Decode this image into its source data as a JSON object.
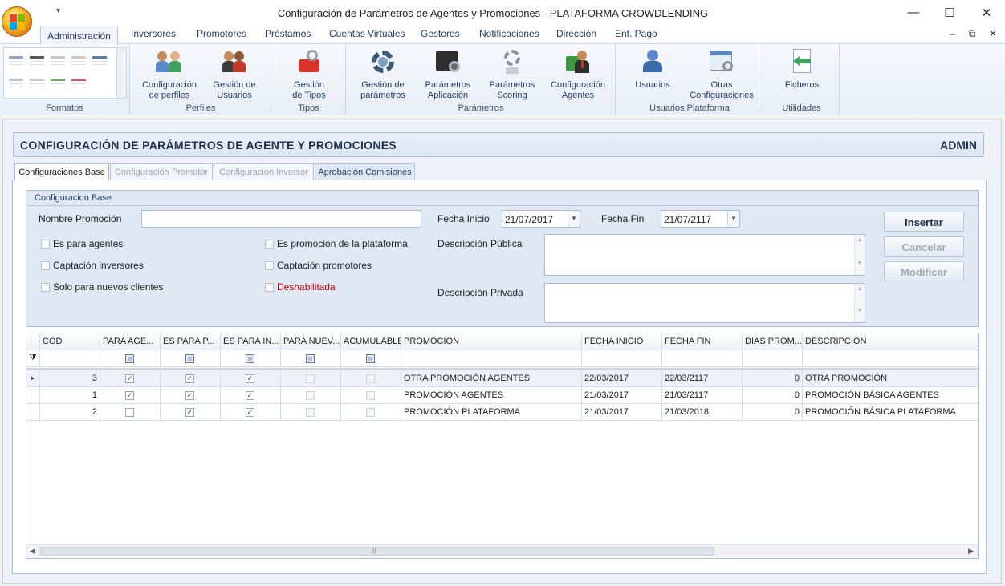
{
  "window": {
    "title": "Configuración de Parámetros de Agentes y Promociones - PLATAFORMA CROWDLENDING",
    "qat_glyph": "▾",
    "min_glyph": "—",
    "max_glyph": "☐",
    "close_glyph": "✕"
  },
  "ribbon_tabs": [
    "Administración",
    "Inversores",
    "Promotores",
    "Préstamos",
    "Cuentas Virtuales",
    "Gestores",
    "Notificaciones",
    "Dirección",
    "Ent. Pago"
  ],
  "mdi": {
    "min": "–",
    "restore": "⧉",
    "close": "✕"
  },
  "ribbon": {
    "groups": {
      "formatos": "Formatos",
      "perfiles": "Perfiles",
      "tipos": "Tipos",
      "parametros": "Parámetros",
      "usuarios_plataforma": "Usuarios Plataforma",
      "utilidades": "Utilidades"
    },
    "buttons": {
      "config_perfiles": [
        "Configuración",
        "de perfiles"
      ],
      "gestion_usuarios": [
        "Gestión de",
        "Usuarios"
      ],
      "gestion_tipos": [
        "Gestión",
        "de Tipos"
      ],
      "gestion_parametros": [
        "Gestión de",
        "parámetros"
      ],
      "param_aplicacion": [
        "Parámetros",
        "Aplicación"
      ],
      "param_scoring": [
        "Parámetros",
        "Scoring"
      ],
      "config_agentes": [
        "Configuración",
        "Agentes"
      ],
      "usuarios": [
        "Usuarios",
        ""
      ],
      "otras_config": [
        "Otras",
        "Configuraciones"
      ],
      "ficheros": [
        "Ficheros",
        ""
      ]
    }
  },
  "header": {
    "title": "CONFIGURACIÓN DE PARÁMETROS DE AGENTE Y PROMOCIONES",
    "user": "ADMIN"
  },
  "page_tabs": [
    "Configuraciones Base",
    "Configuración Promotor",
    "Configuracion Inversor",
    "Aprobación Comisiones"
  ],
  "form": {
    "group_caption": "Configuracion Base",
    "nombre_label": "Nombre Promoción",
    "nombre_value": "",
    "fecha_inicio_label": "Fecha Inicio",
    "fecha_inicio_value": "21/07/2017",
    "fecha_fin_label": "Fecha Fin",
    "fecha_fin_value": "21/07/2117",
    "desc_publica_label": "Descripción Pública",
    "desc_privada_label": "Descripción Privada",
    "checkboxes": {
      "es_para_agentes": "Es para agentes",
      "captacion_inversores": "Captación inversores",
      "solo_nuevos": "Solo para nuevos clientes",
      "es_promocion_plataforma": "Es promoción de la plataforma",
      "captacion_promotores": "Captación promotores",
      "deshabilitada": "Deshabilitada"
    },
    "deshabilitada_color": "#c0000c",
    "buttons": {
      "insertar": "Insertar",
      "cancelar": "Cancelar",
      "modificar": "Modificar"
    }
  },
  "grid": {
    "columns": [
      "COD",
      "PARA AGE...",
      "ES PARA P...",
      "ES PARA IN...",
      "PARA NUEV...",
      "ACUMULABLE",
      "PROMOCION",
      "FECHA INICIO",
      "FECHA FIN",
      "DIAS PROM...",
      "DESCRIPCION"
    ],
    "filter_glyph": "⧩",
    "current_row_glyph": "▸",
    "check_glyph": "✓",
    "rows": [
      {
        "cod": "3",
        "para_agentes": true,
        "es_para_p": true,
        "es_para_in": true,
        "para_nuevos": false,
        "acumulable": false,
        "promocion": "OTRA PROMOCIÓN AGENTES",
        "fecha_inicio": "22/03/2017",
        "fecha_fin": "22/03/2117",
        "dias": "0",
        "descripcion": "OTRA PROMOCIÓN"
      },
      {
        "cod": "1",
        "para_agentes": true,
        "es_para_p": true,
        "es_para_in": true,
        "para_nuevos": false,
        "acumulable": false,
        "promocion": "PROMOCIÓN AGENTES",
        "fecha_inicio": "21/03/2017",
        "fecha_fin": "21/03/2117",
        "dias": "0",
        "descripcion": "PROMOCIÓN BÁSICA AGENTES"
      },
      {
        "cod": "2",
        "para_agentes": false,
        "es_para_p": true,
        "es_para_in": true,
        "para_nuevos": false,
        "acumulable": false,
        "promocion": "PROMOCIÓN PLATAFORMA",
        "fecha_inicio": "21/03/2017",
        "fecha_fin": "21/03/2018",
        "dias": "0",
        "descripcion": "PROMOCIÓN BÁSICA PLATAFORMA"
      }
    ]
  },
  "colors": {
    "accent": "#1e3a5f",
    "selection": "#dfe8f3"
  }
}
